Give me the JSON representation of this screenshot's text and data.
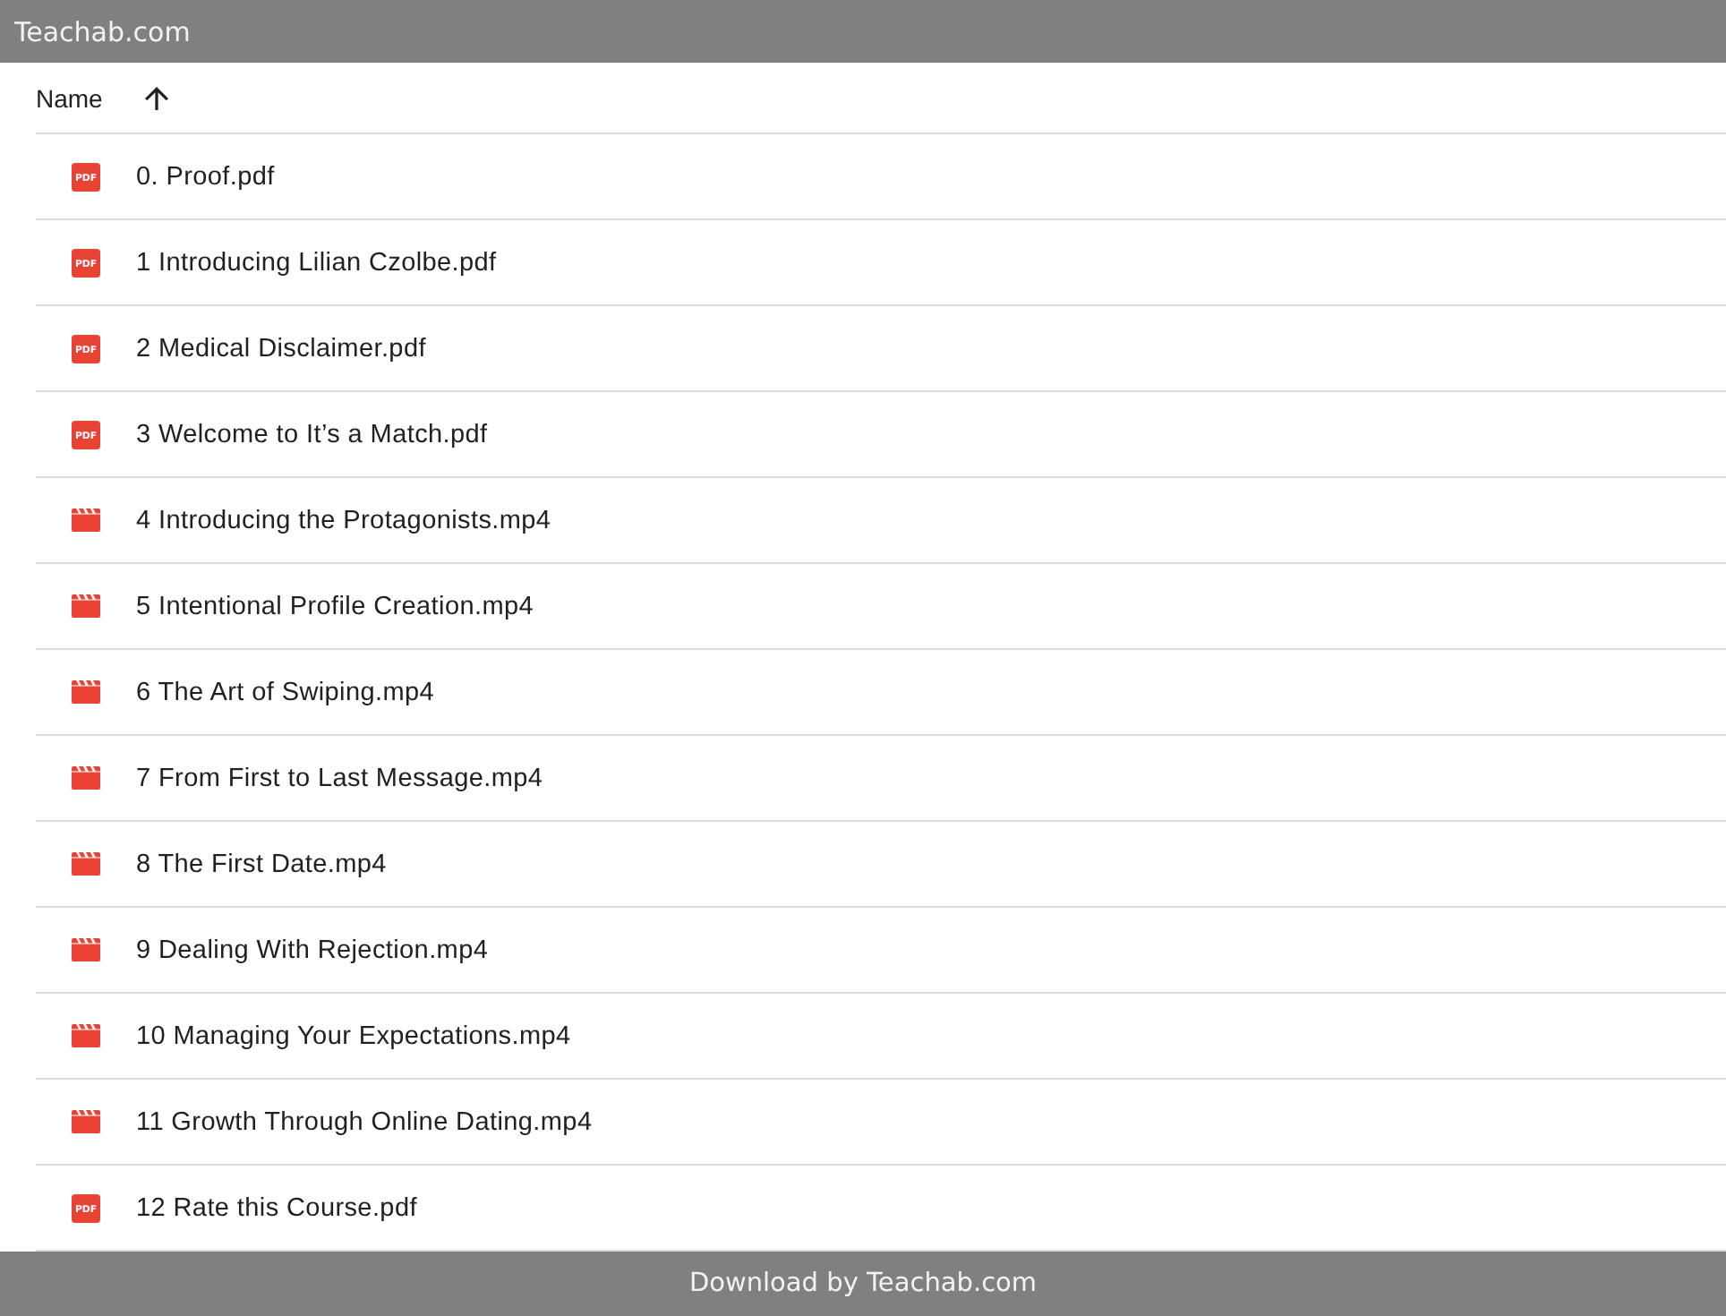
{
  "header": {
    "title": "Teachab.com"
  },
  "list": {
    "columns": [
      {
        "label": "Name",
        "sort_ascending": true
      }
    ],
    "files": [
      {
        "name": "0. Proof.pdf",
        "kind": "pdf",
        "icon_text": "PDF"
      },
      {
        "name": "1 Introducing Lilian Czolbe.pdf",
        "kind": "pdf",
        "icon_text": "PDF"
      },
      {
        "name": "2 Medical Disclaimer.pdf",
        "kind": "pdf",
        "icon_text": "PDF"
      },
      {
        "name": "3 Welcome to It’s a Match.pdf",
        "kind": "pdf",
        "icon_text": "PDF"
      },
      {
        "name": "4 Introducing the Protagonists.mp4",
        "kind": "video"
      },
      {
        "name": "5 Intentional Profile Creation.mp4",
        "kind": "video"
      },
      {
        "name": "6 The Art of Swiping.mp4",
        "kind": "video"
      },
      {
        "name": "7 From First to Last Message.mp4",
        "kind": "video"
      },
      {
        "name": "8 The First Date.mp4",
        "kind": "video"
      },
      {
        "name": "9 Dealing With Rejection.mp4",
        "kind": "video"
      },
      {
        "name": "10 Managing Your Expectations.mp4",
        "kind": "video"
      },
      {
        "name": "11 Growth Through Online Dating.mp4",
        "kind": "video"
      },
      {
        "name": "12 Rate this Course.pdf",
        "kind": "pdf",
        "icon_text": "PDF"
      }
    ]
  },
  "footer": {
    "text": "Download by Teachab.com"
  }
}
